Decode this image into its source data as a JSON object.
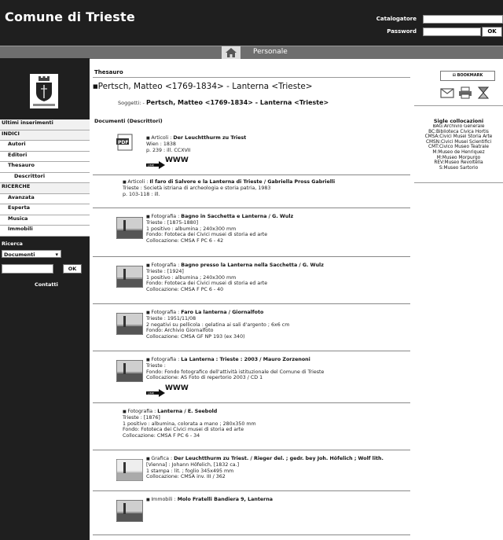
{
  "header": {
    "site_title": "Comune di Trieste",
    "catalogatore_label": "Catalogatore",
    "password_label": "Password",
    "ok_label": "OK"
  },
  "navbar": {
    "personale": "Personale"
  },
  "sidebar": {
    "items": [
      {
        "label": "Ultimi inserimenti",
        "kind": "head"
      },
      {
        "label": "INDICI",
        "kind": "head"
      },
      {
        "label": "Autori",
        "kind": "item"
      },
      {
        "label": "Editori",
        "kind": "item"
      },
      {
        "label": "Thesauro",
        "kind": "item"
      },
      {
        "label": "Descrittori",
        "kind": "sub"
      },
      {
        "label": "RICERCHE",
        "kind": "head"
      },
      {
        "label": "Avanzata",
        "kind": "item"
      },
      {
        "label": "Esperta",
        "kind": "item"
      },
      {
        "label": "Musica",
        "kind": "item"
      },
      {
        "label": "Immobili",
        "kind": "item"
      }
    ],
    "ricerca_label": "Ricerca",
    "ricerca_select": "Documenti",
    "ricerca_ok": "OK",
    "contatti": "Contatti"
  },
  "main": {
    "breadcrumb": "Thesauro",
    "heading": "Pertsch, Matteo <1769-1834> - Lanterna <Trieste>",
    "soggetti_label": "Soggetti: -",
    "soggetti_value": "Pertsch, Matteo <1769-1834> - Lanterna <Trieste>",
    "documents_label": "Documenti (Descrittori)",
    "www_label": "WWW",
    "records": [
      {
        "type": "Articoli",
        "title": "Der Leuchtthurm zu Triest",
        "lines": [
          "Wien : 1838",
          "p. 239 : ill. CCXVII"
        ],
        "thumb": "pdf",
        "link": true
      },
      {
        "type": "Articoli",
        "title": "Il faro di Salvore e la Lanterna di Trieste / Gabriella Pross Gabrielli",
        "lines": [
          "Trieste : Società istriana di archeologia e storia patria, 1983",
          "p. 103-118 : ill."
        ],
        "thumb": "none",
        "link": false
      },
      {
        "type": "Fotografia",
        "title": "Bagno in Sacchetta e Lanterna / G. Wulz",
        "lines": [
          "Trieste : [1875-1880]",
          "1 positivo : albumina ; 240x300 mm",
          "Fondo: Fototeca dei Civici musei di storia ed arte",
          "Collocazione: CMSA F PC 6 - 42"
        ],
        "thumb": "photo",
        "link": false
      },
      {
        "type": "Fotografia",
        "title": "Bagno presso la Lanterna nella Sacchetta / G. Wulz",
        "lines": [
          "Trieste : [1924]",
          "1 positivo : albumina ; 240x300 mm",
          "Fondo: Fototeca dei Civici musei di storia ed arte",
          "Collocazione: CMSA F PC 6 - 40"
        ],
        "thumb": "photo",
        "link": false
      },
      {
        "type": "Fotografia",
        "title": "Faro La lanterna / Giornalfoto",
        "lines": [
          "Trieste : 1951/11/08",
          "2 negativi su pellicola : gelatina ai sali d'argento ; 6x6 cm",
          "Fondo: Archivio Giornalfoto",
          "Collocazione: CMSA GF NP 193 (ex 340)"
        ],
        "thumb": "photo",
        "link": false
      },
      {
        "type": "Fotografia",
        "title": "La Lanterna : Trieste : 2003 / Mauro Zorzenoni",
        "lines": [
          "Trieste :",
          "Fondo: Fondo fotografico dell'attività istituzionale del Comune di Trieste",
          "Collocazione: AS Foto di repertorio 2003 / CD 1"
        ],
        "thumb": "photo",
        "link": true
      },
      {
        "type": "Fotografia",
        "title": "Lanterna / E. Seebold",
        "lines": [
          "Trieste : [1876]",
          "1 positivo : albumina, colorata a mano ; 280x350 mm",
          "Fondo: Fototeca dei Civici musei di storia ed arte",
          "Collocazione: CMSA F PC 6 - 34"
        ],
        "thumb": "none",
        "link": false
      },
      {
        "type": "Grafica",
        "title": "Der Leuchtthurm zu Triest. / Rieger del. ; gedr. bey Joh. Höfelich ; Wolf lith.",
        "lines": [
          "[Vienna] : Johann Höfelich, [1832 ca.]",
          "1 stampa : lit. ; foglio 345x495 mm",
          "Collocazione: CMSA inv. III / 362"
        ],
        "thumb": "print",
        "link": false
      },
      {
        "type": "Immobili",
        "title": "Molo Fratelli Bandiera 9, Lanterna",
        "lines": [],
        "thumb": "photo",
        "link": false
      }
    ]
  },
  "right": {
    "bookmark_label": "BOOKMARK",
    "sigle_title": "Sigle collocazioni",
    "sigle": [
      "BAG:Archivio Generale",
      "BC:Biblioteca Civica Hortis",
      "CMSA:Civici Musei Storia Arte",
      "CMSN:Civici Musei Scientifici",
      "CMT:Civico Museo Teatrale",
      "M:Museo de Henriquez",
      "M:Museo Morpurgo",
      "REV:Museo Revoltella",
      "S:Museo Sartorio"
    ]
  }
}
